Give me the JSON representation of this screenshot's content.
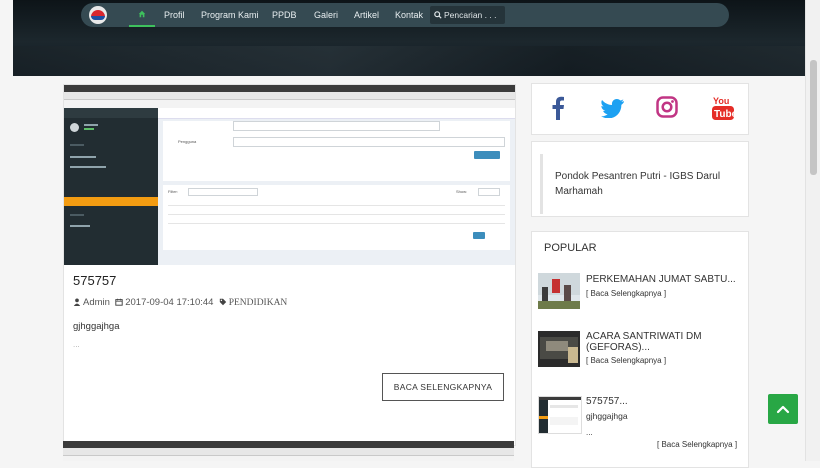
{
  "nav": {
    "items": [
      "Profil",
      "Program Kami",
      "PPDB",
      "Galeri",
      "Artikel",
      "Kontak"
    ],
    "search_placeholder": "Pencarian . . ."
  },
  "post": {
    "title": "575757",
    "author": "Admin",
    "date": "2017-09-04 17:10:44",
    "category": "PENDIDIKAN",
    "excerpt": "gjhggajhga",
    "ellipsis": "...",
    "read_more": "BACA SELENGKAPNYA"
  },
  "sidebar": {
    "social": [
      "facebook-icon",
      "twitter-icon",
      "instagram-icon",
      "youtube-icon"
    ],
    "school_name": "Pondok Pesantren Putri - IGBS Darul Marhamah",
    "popular_title": "POPULAR",
    "popular": [
      {
        "title": "PERKEMAHAN JUMAT SABTU...",
        "link": "[ Baca Selengkapnya ]"
      },
      {
        "title": "ACARA SANTRIWATI DM (GEFORAS)...",
        "link": "[ Baca Selengkapnya ]"
      },
      {
        "title": "575757...",
        "excerpt": "gjhggajhga",
        "more": "...",
        "link": "[ Baca Selengkapnya ]"
      }
    ]
  },
  "colors": {
    "nav_bg": "#354a52",
    "accent_green": "#28a745",
    "facebook": "#3b5998",
    "twitter": "#1da1f2",
    "instagram": "#c13584",
    "youtube": "#e52d27"
  }
}
